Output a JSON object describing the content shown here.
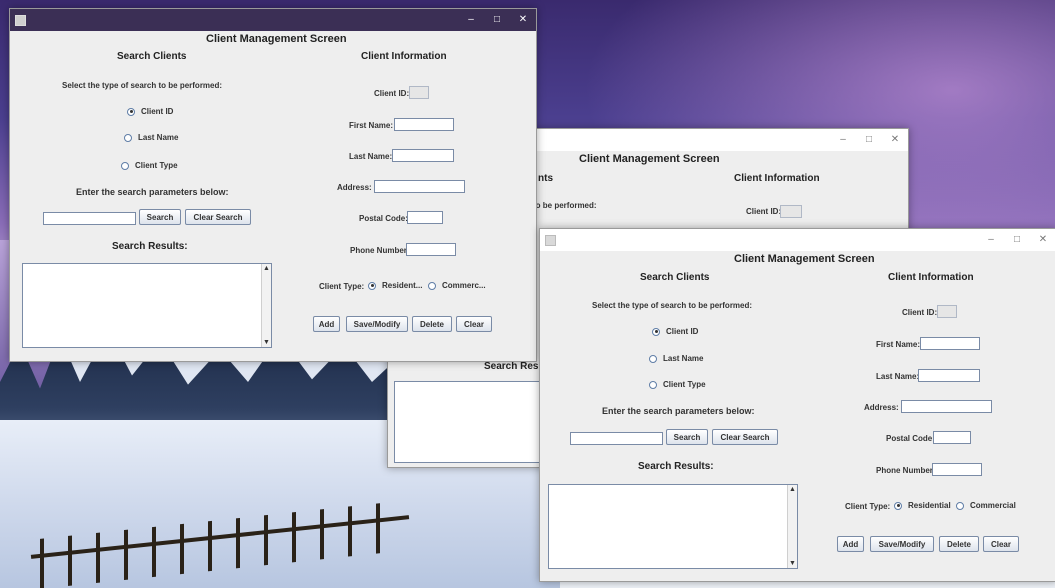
{
  "windows": {
    "front": {
      "title": "Client Management Screen",
      "search": {
        "heading": "Search Clients",
        "select_prompt": "Select the type of search to be performed:",
        "options": [
          "Client ID",
          "Last Name",
          "Client Type"
        ],
        "selected": "Client ID",
        "params_prompt": "Enter the search parameters below:",
        "search_button": "Search",
        "clear_search_button": "Clear Search",
        "results_heading": "Search Results:"
      },
      "info": {
        "heading": "Client Information",
        "client_id_label": "Client ID:",
        "first_name_label": "First Name:",
        "last_name_label": "Last Name:",
        "address_label": "Address:",
        "postal_code_label": "Postal Code:",
        "phone_label": "Phone Number:",
        "client_type_label": "Client Type:",
        "type_options": [
          "Residential",
          "Commercial"
        ],
        "selected_type": "Residential"
      },
      "actions": {
        "add": "Add",
        "save": "Save/Modify",
        "delete": "Delete",
        "clear": "Clear"
      },
      "controls": {
        "minimize": "–",
        "maximize": "□",
        "close": "✕"
      }
    },
    "middle": {
      "title": "Client Management Screen",
      "search_heading_partial": "nts",
      "select_prompt_partial": "to be performed:",
      "results_heading_partial": "Search Resu",
      "info_heading": "Client Information",
      "client_id_label": "Client ID:",
      "controls": {
        "minimize": "–",
        "maximize": "□",
        "close": "✕"
      }
    },
    "back": {
      "title": "Client Management Screen",
      "search": {
        "heading": "Search Clients",
        "select_prompt": "Select the type of search to be performed:",
        "options": [
          "Client ID",
          "Last Name",
          "Client Type"
        ],
        "selected": "Client ID",
        "params_prompt": "Enter the search parameters below:",
        "search_button": "Search",
        "clear_search_button": "Clear Search",
        "results_heading": "Search Results:"
      },
      "info": {
        "heading": "Client Information",
        "client_id_label": "Client ID:",
        "first_name_label": "First Name:",
        "last_name_label": "Last Name:",
        "address_label": "Address:",
        "postal_code_label": "Postal Code:",
        "phone_label": "Phone Number:",
        "client_type_label": "Client Type:",
        "type_options": [
          "Resident...",
          "Commerc..."
        ],
        "selected_type": "Resident..."
      },
      "actions": {
        "add": "Add",
        "save": "Save/Modify",
        "delete": "Delete",
        "clear": "Clear"
      },
      "controls": {
        "minimize": "–",
        "maximize": "□",
        "close": "✕"
      }
    }
  }
}
